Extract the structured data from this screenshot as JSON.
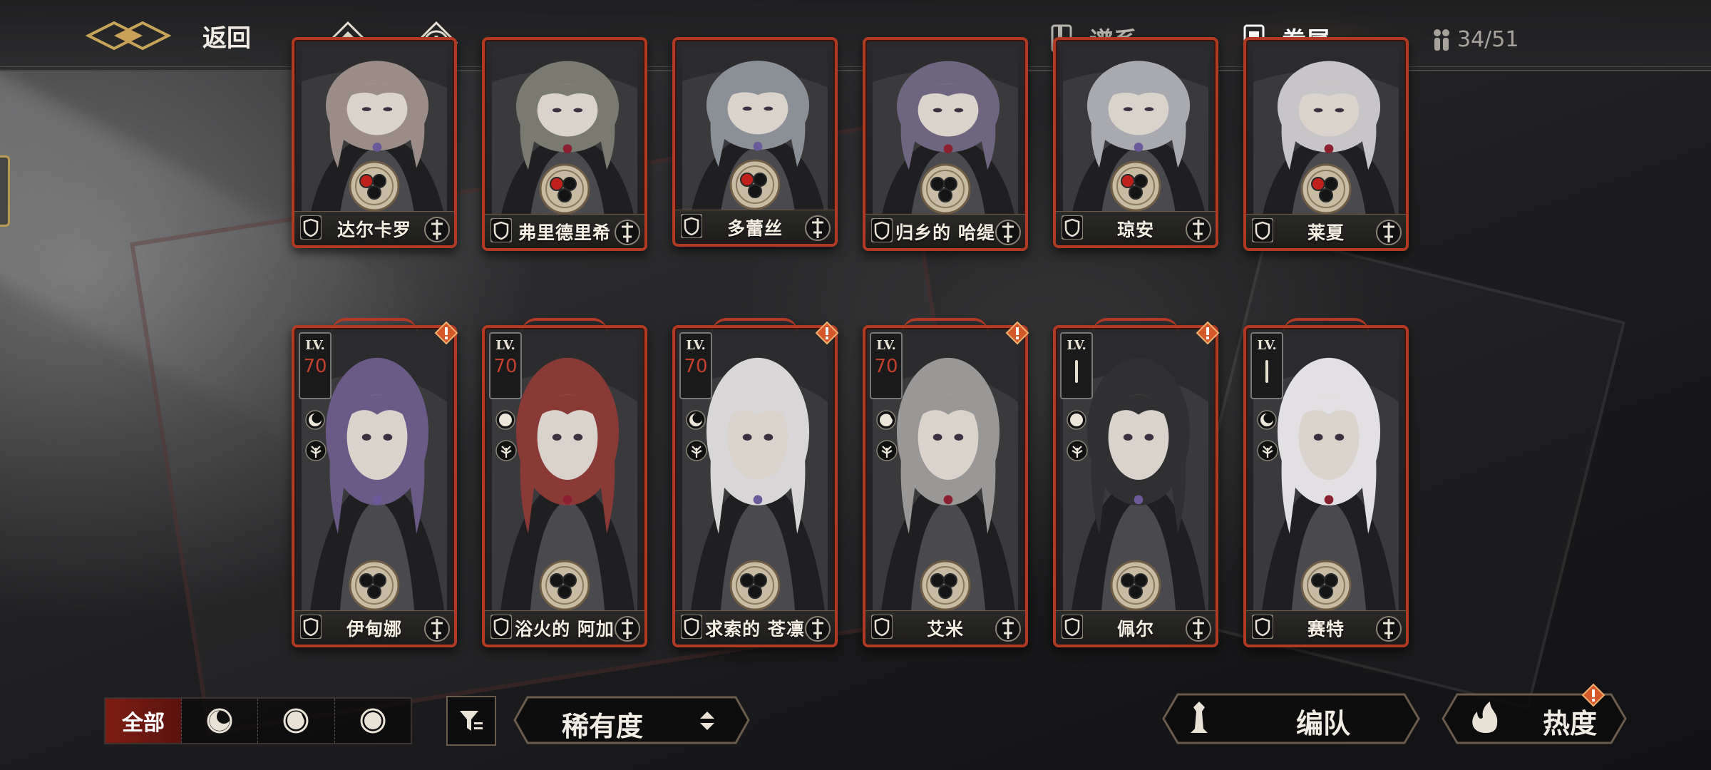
{
  "header": {
    "back_label": "返回",
    "tabs": [
      {
        "label": "谱系",
        "active": false
      },
      {
        "label": "眷属",
        "active": true
      }
    ],
    "count": "34/51"
  },
  "cards_top": [
    {
      "name": "达尔卡罗",
      "hair": "#9a8c86",
      "gems": [
        "red",
        "black",
        "black"
      ]
    },
    {
      "name": "弗里德里希",
      "hair": "#7b7a70",
      "gems": [
        "red",
        "black",
        "black"
      ]
    },
    {
      "name": "多蕾丝",
      "hair": "#8b9096",
      "gems": [
        "red",
        "black",
        "black"
      ]
    },
    {
      "name": "归乡的 哈缇",
      "hair": "#6e6680",
      "gems": [
        "black",
        "black",
        "black"
      ]
    },
    {
      "name": "琼安",
      "hair": "#a8aab0",
      "gems": [
        "red",
        "black",
        "black"
      ]
    },
    {
      "name": "莱夏",
      "hair": "#c7c5c7",
      "gems": [
        "red",
        "black",
        "black"
      ]
    }
  ],
  "cards_bottom": [
    {
      "name": "伊甸娜",
      "lv_label": "LV.",
      "lv": "70",
      "element": "crescent",
      "hair": "#6a5a86",
      "alert": true
    },
    {
      "name": "浴火的 阿加",
      "lv_label": "LV.",
      "lv": "70",
      "element": "full",
      "hair": "#8a3a36",
      "alert": false
    },
    {
      "name": "求索的 苍凛",
      "lv_label": "LV.",
      "lv": "70",
      "element": "crescent",
      "hair": "#d8d6d6",
      "alert": true
    },
    {
      "name": "艾米",
      "lv_label": "LV.",
      "lv": "70",
      "element": "half",
      "hair": "#9a9896",
      "alert": true
    },
    {
      "name": "佩尔",
      "lv_label": "LV.",
      "lv": "",
      "element": "full",
      "hair": "#303032",
      "alert": true
    },
    {
      "name": "赛特",
      "lv_label": "LV.",
      "lv": "",
      "element": "crescent",
      "hair": "#e2e0e2",
      "alert": false
    }
  ],
  "bottom": {
    "filter_all": "全部",
    "filter_options": [
      "crescent-moon",
      "half-moon",
      "full-moon"
    ],
    "sort_label": "稀有度",
    "team_label": "编队",
    "heat_label": "热度"
  },
  "colors": {
    "card_border": "#b23a24",
    "accent_gold": "#c9a25a",
    "lv_red": "#c4402e"
  }
}
